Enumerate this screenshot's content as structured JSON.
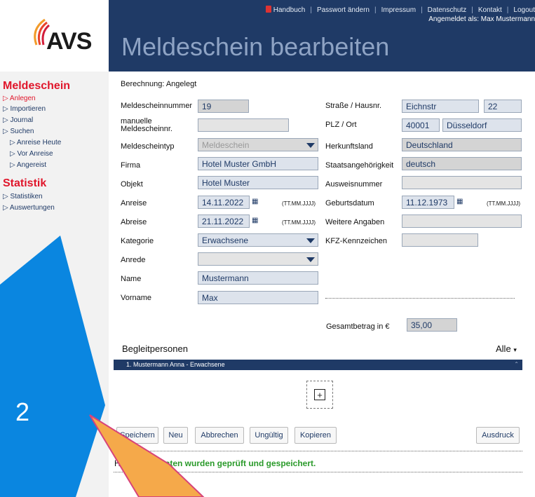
{
  "header": {
    "logo_text": "AVS",
    "links": [
      "Handbuch",
      "Passwort ändern",
      "Impressum",
      "Datenschutz",
      "Kontakt",
      "Logout"
    ],
    "logged_in": "Angemeldet als: Max Mustermann",
    "page_title": "Meldeschein bearbeiten"
  },
  "sidebar": {
    "section1": "Meldeschein",
    "items1": [
      "Anlegen",
      "Importieren",
      "Journal",
      "Suchen"
    ],
    "subitems": [
      "Anreise Heute",
      "Vor Anreise",
      "Angereist"
    ],
    "section2": "Statistik",
    "items2": [
      "Statistiken",
      "Auswertungen"
    ]
  },
  "form": {
    "berechnung": "Berechnung: Angelegt",
    "left": {
      "meldescheinnummer_label": "Meldescheinnummer",
      "meldescheinnummer": "19",
      "manuelle_label_1": "manuelle",
      "manuelle_label_2": "Meldescheinnr.",
      "manuelle": "",
      "typ_label": "Meldescheintyp",
      "typ": "Meldeschein",
      "firma_label": "Firma",
      "firma": "Hotel Muster GmbH",
      "objekt_label": "Objekt",
      "objekt": "Hotel Muster",
      "anreise_label": "Anreise",
      "anreise": "14.11.2022",
      "abreise_label": "Abreise",
      "abreise": "21.11.2022",
      "date_hint": "(TT.MM.JJJJ)",
      "kategorie_label": "Kategorie",
      "kategorie": "Erwachsene",
      "anrede_label": "Anrede",
      "anrede": "",
      "name_label": "Name",
      "name": "Mustermann",
      "vorname_label": "Vorname",
      "vorname": "Max"
    },
    "right": {
      "strasse_label": "Straße / Hausnr.",
      "strasse": "Eichnstr",
      "hausnr": "22",
      "plz_label": "PLZ / Ort",
      "plz": "40001",
      "ort": "Düsseldorf",
      "herkunft_label": "Herkunftsland",
      "herkunft": "Deutschland",
      "staat_label": "Staatsangehörigkeit",
      "staat": "deutsch",
      "ausweis_label": "Ausweisnummer",
      "ausweis": "",
      "geburt_label": "Geburtsdatum",
      "geburt": "11.12.1973",
      "date_hint": "(TT.MM.JJJJ)",
      "weitere_label": "Weitere Angaben",
      "weitere": "",
      "kfz_label": "KFZ-Kennzeichen",
      "kfz": ""
    },
    "gesamt_label": "Gesamtbetrag in €",
    "gesamt": "35,00"
  },
  "begleit": {
    "title": "Begleitpersonen",
    "filter": "Alle",
    "row1": "1. Mustermann Anna - Erwachsene"
  },
  "buttons": {
    "speichern": "Speichern",
    "neu": "Neu",
    "abbrechen": "Abbrechen",
    "ungueltig": "Ungültig",
    "kopieren": "Kopieren",
    "ausdruck": "Ausdruck"
  },
  "status": {
    "prefix": "Hi",
    "message": "Daten wurden geprüft und gespeichert."
  },
  "annotation": {
    "number": "2",
    "blue": "#0a86e0",
    "orange": "#f5a94a"
  },
  "colors": {
    "header": "#1f3a66",
    "accent": "#e0162b",
    "success": "#2a9a2a"
  }
}
